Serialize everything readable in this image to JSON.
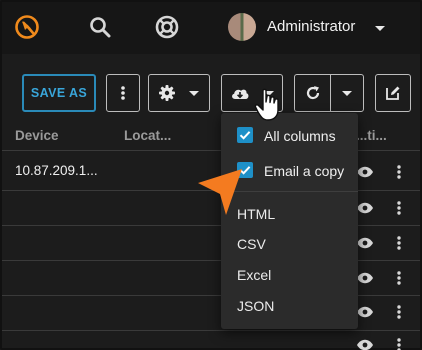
{
  "header": {
    "user_name": "Administrator",
    "icons": [
      "logo-icon",
      "search-icon",
      "help-icon",
      "avatar",
      "chevron-down-icon"
    ]
  },
  "toolbar": {
    "save_as_label": "SAVE AS",
    "icons": [
      "more-vertical-icon",
      "gear-icon",
      "cloud-download-icon",
      "refresh-icon",
      "edit-icon"
    ]
  },
  "table": {
    "columns": [
      "Device",
      "Locat...",
      "...ti..."
    ],
    "rows": [
      {
        "device": "10.87.209.1..."
      },
      {
        "device": ""
      },
      {
        "device": ""
      },
      {
        "device": ""
      },
      {
        "device": ""
      },
      {
        "device": ""
      }
    ]
  },
  "download_menu": {
    "options": [
      {
        "label": "All columns",
        "checked": true
      },
      {
        "label": "Email a copy",
        "checked": true
      }
    ],
    "formats": [
      "HTML",
      "CSV",
      "Excel",
      "JSON"
    ]
  },
  "colors": {
    "accent": "#1e90c8",
    "save_as": "#39a6da",
    "logo": "#f08a1c",
    "callout_arrow": "#f47b20"
  }
}
